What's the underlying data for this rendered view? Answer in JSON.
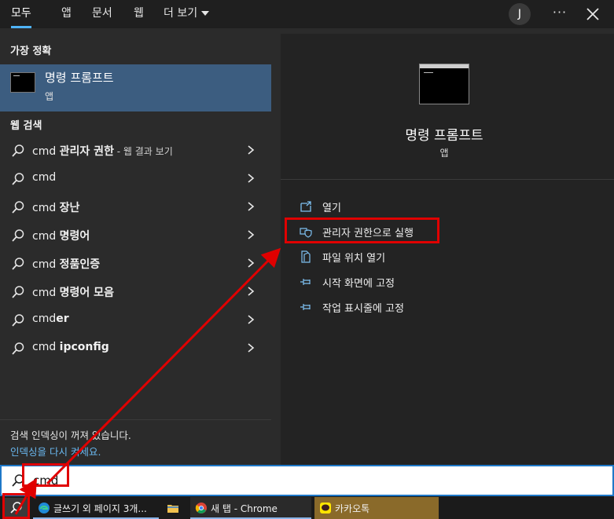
{
  "tabs": [
    {
      "label": "모두",
      "active": true
    },
    {
      "label": "앱"
    },
    {
      "label": "문서"
    },
    {
      "label": "웹"
    },
    {
      "label": "더 보기"
    }
  ],
  "avatar_initial": "J",
  "more_label": "···",
  "best_match": {
    "section_title": "가장 정확",
    "title": "명령 프롬프트",
    "subtitle": "앱"
  },
  "web_search": {
    "section_title": "웹 검색",
    "items": [
      {
        "prefix": "cmd ",
        "bold": "관리자 권한",
        "suffix": " - 웹 결과 보기"
      },
      {
        "prefix": "cmd",
        "bold": "",
        "suffix": ""
      },
      {
        "prefix": "cmd ",
        "bold": "장난",
        "suffix": ""
      },
      {
        "prefix": "cmd ",
        "bold": "명령어",
        "suffix": ""
      },
      {
        "prefix": "cmd ",
        "bold": "정품인증",
        "suffix": ""
      },
      {
        "prefix": "cmd ",
        "bold": "명령어 모음",
        "suffix": ""
      },
      {
        "prefix": "cmd",
        "bold": "er",
        "suffix": ""
      },
      {
        "prefix": "cmd ",
        "bold": "ipconfig",
        "suffix": ""
      }
    ]
  },
  "index_note": {
    "text": "검색 인덱싱이 꺼져 있습니다.",
    "link": "인덱싱을 다시 켜세요."
  },
  "preview": {
    "title": "명령 프롬프트",
    "subtitle": "앱",
    "actions": [
      {
        "label": "열기",
        "icon": "open-icon"
      },
      {
        "label": "관리자 권한으로 실행",
        "icon": "shield-icon"
      },
      {
        "label": "파일 위치 열기",
        "icon": "file-location-icon"
      },
      {
        "label": "시작 화면에 고정",
        "icon": "pin-icon"
      },
      {
        "label": "작업 표시줄에 고정",
        "icon": "pin-icon"
      }
    ]
  },
  "search": {
    "value": "cmd"
  },
  "taskbar": {
    "items": [
      {
        "label": "글쓰기 외 페이지 3개...",
        "icon": "edge-icon"
      },
      {
        "label": "",
        "icon": "folder-icon"
      },
      {
        "label": "새 탭 - Chrome",
        "icon": "chrome-icon"
      },
      {
        "label": "카카오톡",
        "icon": "kakaotalk-icon"
      }
    ]
  },
  "colors": {
    "accent": "#4fb3f6",
    "selected_row": "#3c5d80",
    "annotation": "#e00000",
    "link": "#6ab8f0"
  }
}
